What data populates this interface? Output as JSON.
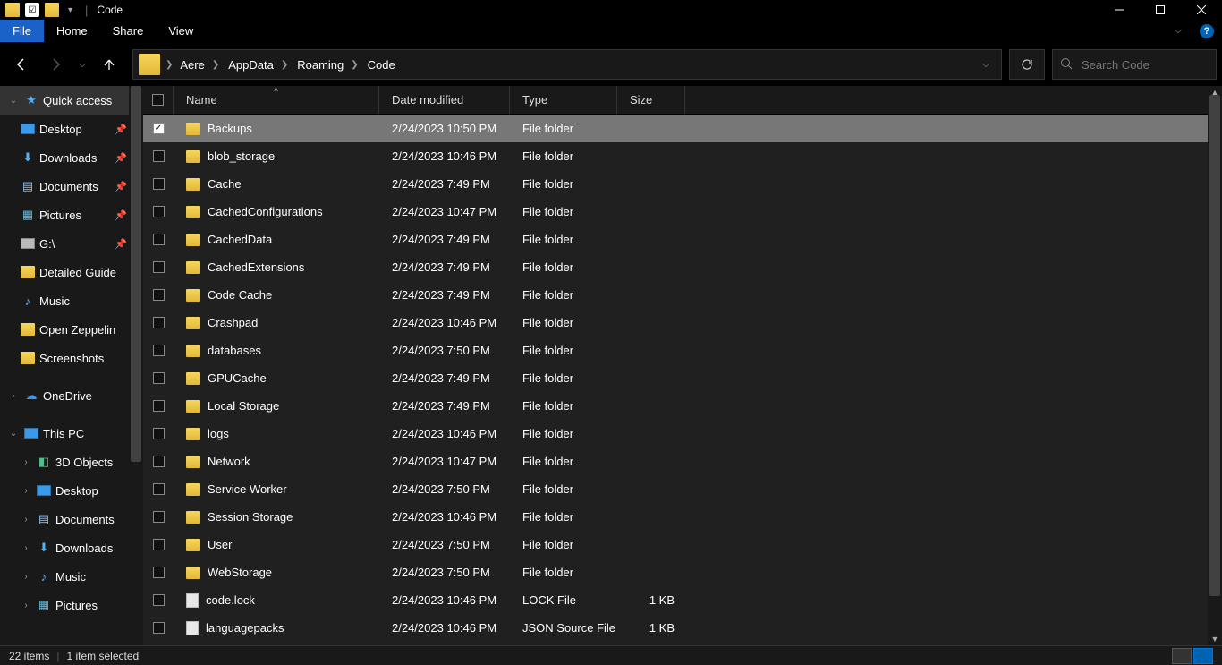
{
  "title": "Code",
  "ribbon": {
    "tabs": [
      "File",
      "Home",
      "Share",
      "View"
    ]
  },
  "nav": {
    "back_enabled": true,
    "forward_enabled": false
  },
  "breadcrumbs": [
    "Aere",
    "AppData",
    "Roaming",
    "Code"
  ],
  "search": {
    "placeholder": "Search Code"
  },
  "sidebar": {
    "quickAccess": {
      "label": "Quick access",
      "expanded": true,
      "items": [
        {
          "label": "Desktop",
          "icon": "monitor",
          "pinned": true
        },
        {
          "label": "Downloads",
          "icon": "download",
          "pinned": true
        },
        {
          "label": "Documents",
          "icon": "doc",
          "pinned": true
        },
        {
          "label": "Pictures",
          "icon": "pic",
          "pinned": true
        },
        {
          "label": "G:\\",
          "icon": "drive",
          "pinned": true
        },
        {
          "label": "Detailed Guide",
          "icon": "folder",
          "pinned": false
        },
        {
          "label": "Music",
          "icon": "music",
          "pinned": false
        },
        {
          "label": "Open Zeppelin",
          "icon": "folder",
          "pinned": false
        },
        {
          "label": "Screenshots",
          "icon": "folder",
          "pinned": false
        }
      ]
    },
    "oneDrive": {
      "label": "OneDrive",
      "expanded": false
    },
    "thisPC": {
      "label": "This PC",
      "expanded": true,
      "items": [
        {
          "label": "3D Objects",
          "icon": "3d"
        },
        {
          "label": "Desktop",
          "icon": "monitor"
        },
        {
          "label": "Documents",
          "icon": "doc"
        },
        {
          "label": "Downloads",
          "icon": "download"
        },
        {
          "label": "Music",
          "icon": "music"
        },
        {
          "label": "Pictures",
          "icon": "pic"
        }
      ]
    }
  },
  "columns": [
    "Name",
    "Date modified",
    "Type",
    "Size"
  ],
  "sortColumn": "Name",
  "rows": [
    {
      "sel": true,
      "icon": "folder",
      "name": "Backups",
      "date": "2/24/2023 10:50 PM",
      "type": "File folder",
      "size": ""
    },
    {
      "sel": false,
      "icon": "folder",
      "name": "blob_storage",
      "date": "2/24/2023 10:46 PM",
      "type": "File folder",
      "size": ""
    },
    {
      "sel": false,
      "icon": "folder",
      "name": "Cache",
      "date": "2/24/2023 7:49 PM",
      "type": "File folder",
      "size": ""
    },
    {
      "sel": false,
      "icon": "folder",
      "name": "CachedConfigurations",
      "date": "2/24/2023 10:47 PM",
      "type": "File folder",
      "size": ""
    },
    {
      "sel": false,
      "icon": "folder",
      "name": "CachedData",
      "date": "2/24/2023 7:49 PM",
      "type": "File folder",
      "size": ""
    },
    {
      "sel": false,
      "icon": "folder",
      "name": "CachedExtensions",
      "date": "2/24/2023 7:49 PM",
      "type": "File folder",
      "size": ""
    },
    {
      "sel": false,
      "icon": "folder",
      "name": "Code Cache",
      "date": "2/24/2023 7:49 PM",
      "type": "File folder",
      "size": ""
    },
    {
      "sel": false,
      "icon": "folder",
      "name": "Crashpad",
      "date": "2/24/2023 10:46 PM",
      "type": "File folder",
      "size": ""
    },
    {
      "sel": false,
      "icon": "folder",
      "name": "databases",
      "date": "2/24/2023 7:50 PM",
      "type": "File folder",
      "size": ""
    },
    {
      "sel": false,
      "icon": "folder",
      "name": "GPUCache",
      "date": "2/24/2023 7:49 PM",
      "type": "File folder",
      "size": ""
    },
    {
      "sel": false,
      "icon": "folder",
      "name": "Local Storage",
      "date": "2/24/2023 7:49 PM",
      "type": "File folder",
      "size": ""
    },
    {
      "sel": false,
      "icon": "folder",
      "name": "logs",
      "date": "2/24/2023 10:46 PM",
      "type": "File folder",
      "size": ""
    },
    {
      "sel": false,
      "icon": "folder",
      "name": "Network",
      "date": "2/24/2023 10:47 PM",
      "type": "File folder",
      "size": ""
    },
    {
      "sel": false,
      "icon": "folder",
      "name": "Service Worker",
      "date": "2/24/2023 7:50 PM",
      "type": "File folder",
      "size": ""
    },
    {
      "sel": false,
      "icon": "folder",
      "name": "Session Storage",
      "date": "2/24/2023 10:46 PM",
      "type": "File folder",
      "size": ""
    },
    {
      "sel": false,
      "icon": "folder",
      "name": "User",
      "date": "2/24/2023 7:50 PM",
      "type": "File folder",
      "size": ""
    },
    {
      "sel": false,
      "icon": "folder",
      "name": "WebStorage",
      "date": "2/24/2023 7:50 PM",
      "type": "File folder",
      "size": ""
    },
    {
      "sel": false,
      "icon": "file",
      "name": "code.lock",
      "date": "2/24/2023 10:46 PM",
      "type": "LOCK File",
      "size": "1 KB"
    },
    {
      "sel": false,
      "icon": "file",
      "name": "languagepacks",
      "date": "2/24/2023 10:46 PM",
      "type": "JSON Source File",
      "size": "1 KB"
    }
  ],
  "status": {
    "count": "22 items",
    "selection": "1 item selected"
  }
}
